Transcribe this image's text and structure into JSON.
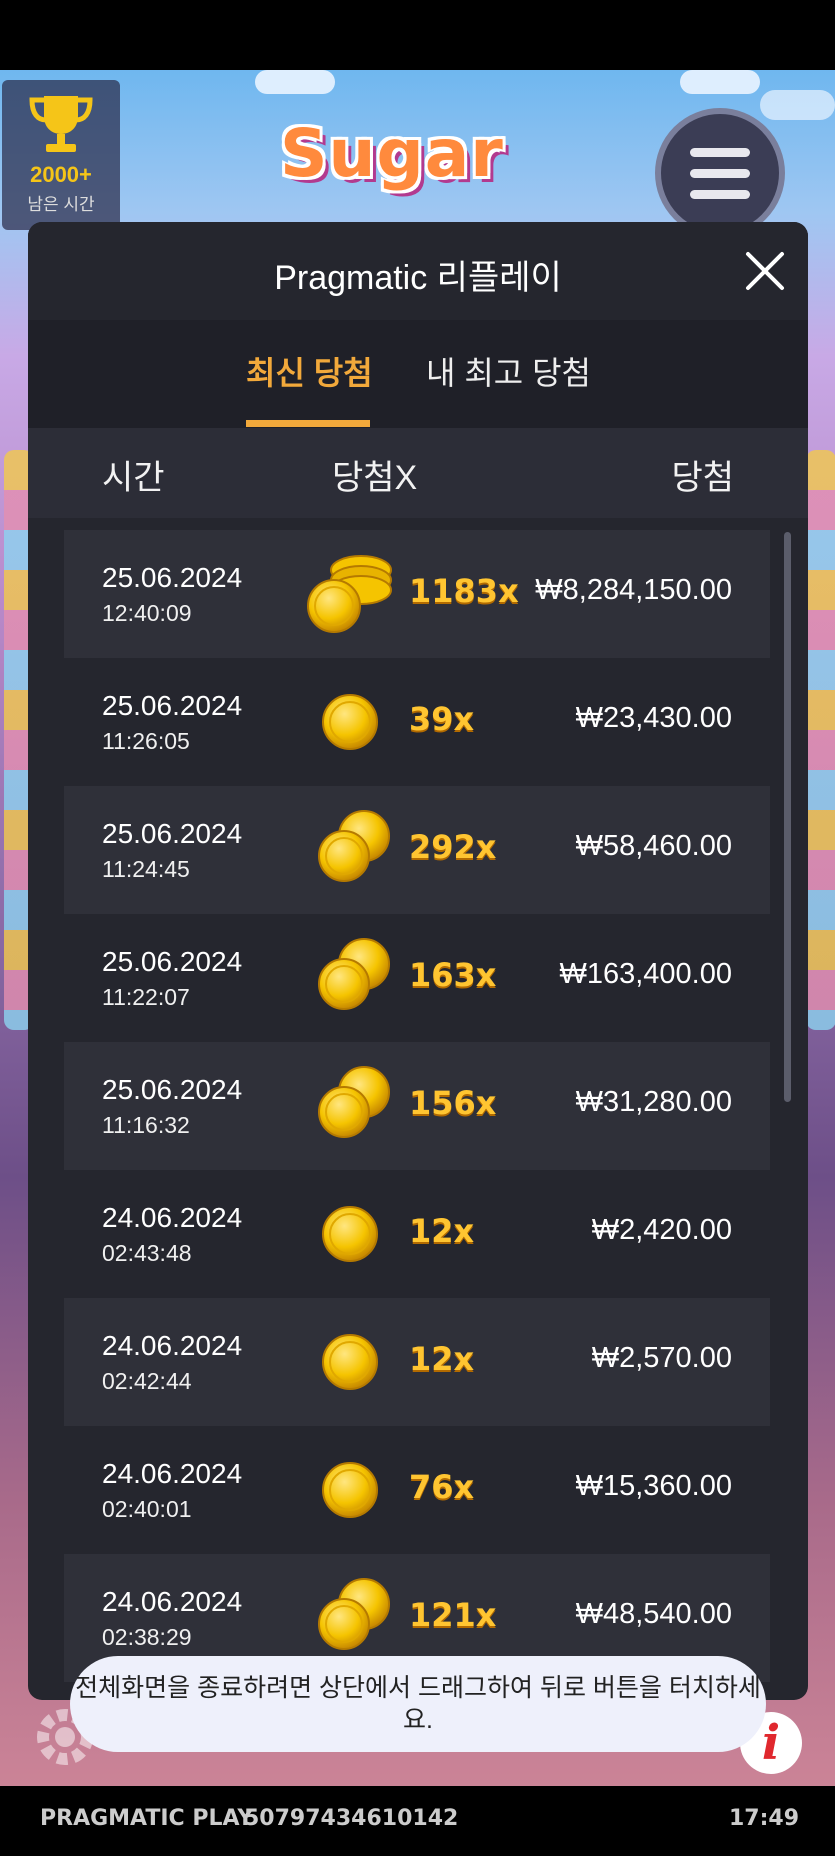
{
  "game": {
    "logo_text": "Sugar",
    "trophy_value": "2000+",
    "trophy_label": "남은 시간"
  },
  "modal": {
    "title": "Pragmatic 리플레이",
    "tabs": [
      {
        "label": "최신 당첨",
        "active": true
      },
      {
        "label": "내 최고 당첨",
        "active": false
      }
    ],
    "columns": {
      "time": "시간",
      "multiplier": "당첨X",
      "win": "당첨"
    },
    "rows": [
      {
        "date": "25.06.2024",
        "time": "12:40:09",
        "multiplier": "1183x",
        "win": "₩8,284,150.00",
        "coin": "stack-icon"
      },
      {
        "date": "25.06.2024",
        "time": "11:26:05",
        "multiplier": "39x",
        "win": "₩23,430.00",
        "coin": "single-coin-icon"
      },
      {
        "date": "25.06.2024",
        "time": "11:24:45",
        "multiplier": "292x",
        "win": "₩58,460.00",
        "coin": "double-coin-icon"
      },
      {
        "date": "25.06.2024",
        "time": "11:22:07",
        "multiplier": "163x",
        "win": "₩163,400.00",
        "coin": "double-coin-icon"
      },
      {
        "date": "25.06.2024",
        "time": "11:16:32",
        "multiplier": "156x",
        "win": "₩31,280.00",
        "coin": "double-coin-icon"
      },
      {
        "date": "24.06.2024",
        "time": "02:43:48",
        "multiplier": "12x",
        "win": "₩2,420.00",
        "coin": "single-coin-icon"
      },
      {
        "date": "24.06.2024",
        "time": "02:42:44",
        "multiplier": "12x",
        "win": "₩2,570.00",
        "coin": "single-coin-icon"
      },
      {
        "date": "24.06.2024",
        "time": "02:40:01",
        "multiplier": "76x",
        "win": "₩15,360.00",
        "coin": "single-coin-icon"
      },
      {
        "date": "24.06.2024",
        "time": "02:38:29",
        "multiplier": "121x",
        "win": "₩48,540.00",
        "coin": "double-coin-icon"
      }
    ]
  },
  "toast": {
    "message": "전체화면을 종료하려면 상단에서 드래그하여 뒤로 버튼을 터치하세요."
  },
  "footer": {
    "brand": "PRAGMATIC PLAY",
    "id": "50797434610142",
    "clock": "17:49"
  },
  "colors": {
    "accent": "#f2a93b",
    "modal_bg": "#25262e",
    "multiplier": "#ffc531"
  }
}
